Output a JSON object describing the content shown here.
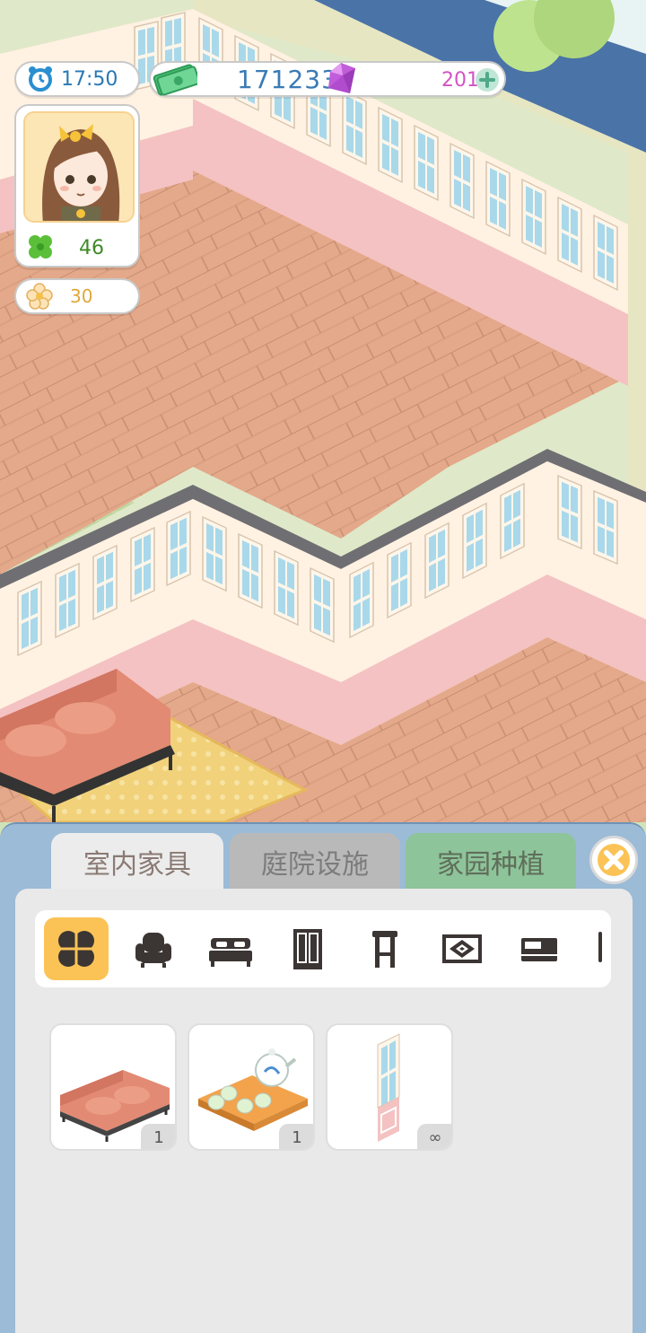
{
  "hud": {
    "clock_time": "17:50",
    "cash_amount": "171233",
    "gem_amount": "201",
    "clover_count": "46",
    "flower_count": "30"
  },
  "panel": {
    "tabs": [
      {
        "label": "室内家具",
        "active": true
      },
      {
        "label": "庭院设施",
        "active": false
      },
      {
        "label": "家园种植",
        "active": false
      }
    ],
    "categories": [
      {
        "icon": "clover-all-icon",
        "active": true
      },
      {
        "icon": "armchair-icon",
        "active": false
      },
      {
        "icon": "bed-icon",
        "active": false
      },
      {
        "icon": "wardrobe-icon",
        "active": false
      },
      {
        "icon": "stool-icon",
        "active": false
      },
      {
        "icon": "rug-icon",
        "active": false
      },
      {
        "icon": "cabinet-icon",
        "active": false
      }
    ],
    "items": [
      {
        "name": "sofa",
        "count": "1"
      },
      {
        "name": "tea-set",
        "count": "1"
      },
      {
        "name": "window-wall",
        "count": "∞"
      }
    ]
  },
  "colors": {
    "wall_pink": "#f4c2c2",
    "floor_wood": "#e3a98a",
    "accent_gold": "#fbc356",
    "panel_blue": "#9bbbd7"
  }
}
